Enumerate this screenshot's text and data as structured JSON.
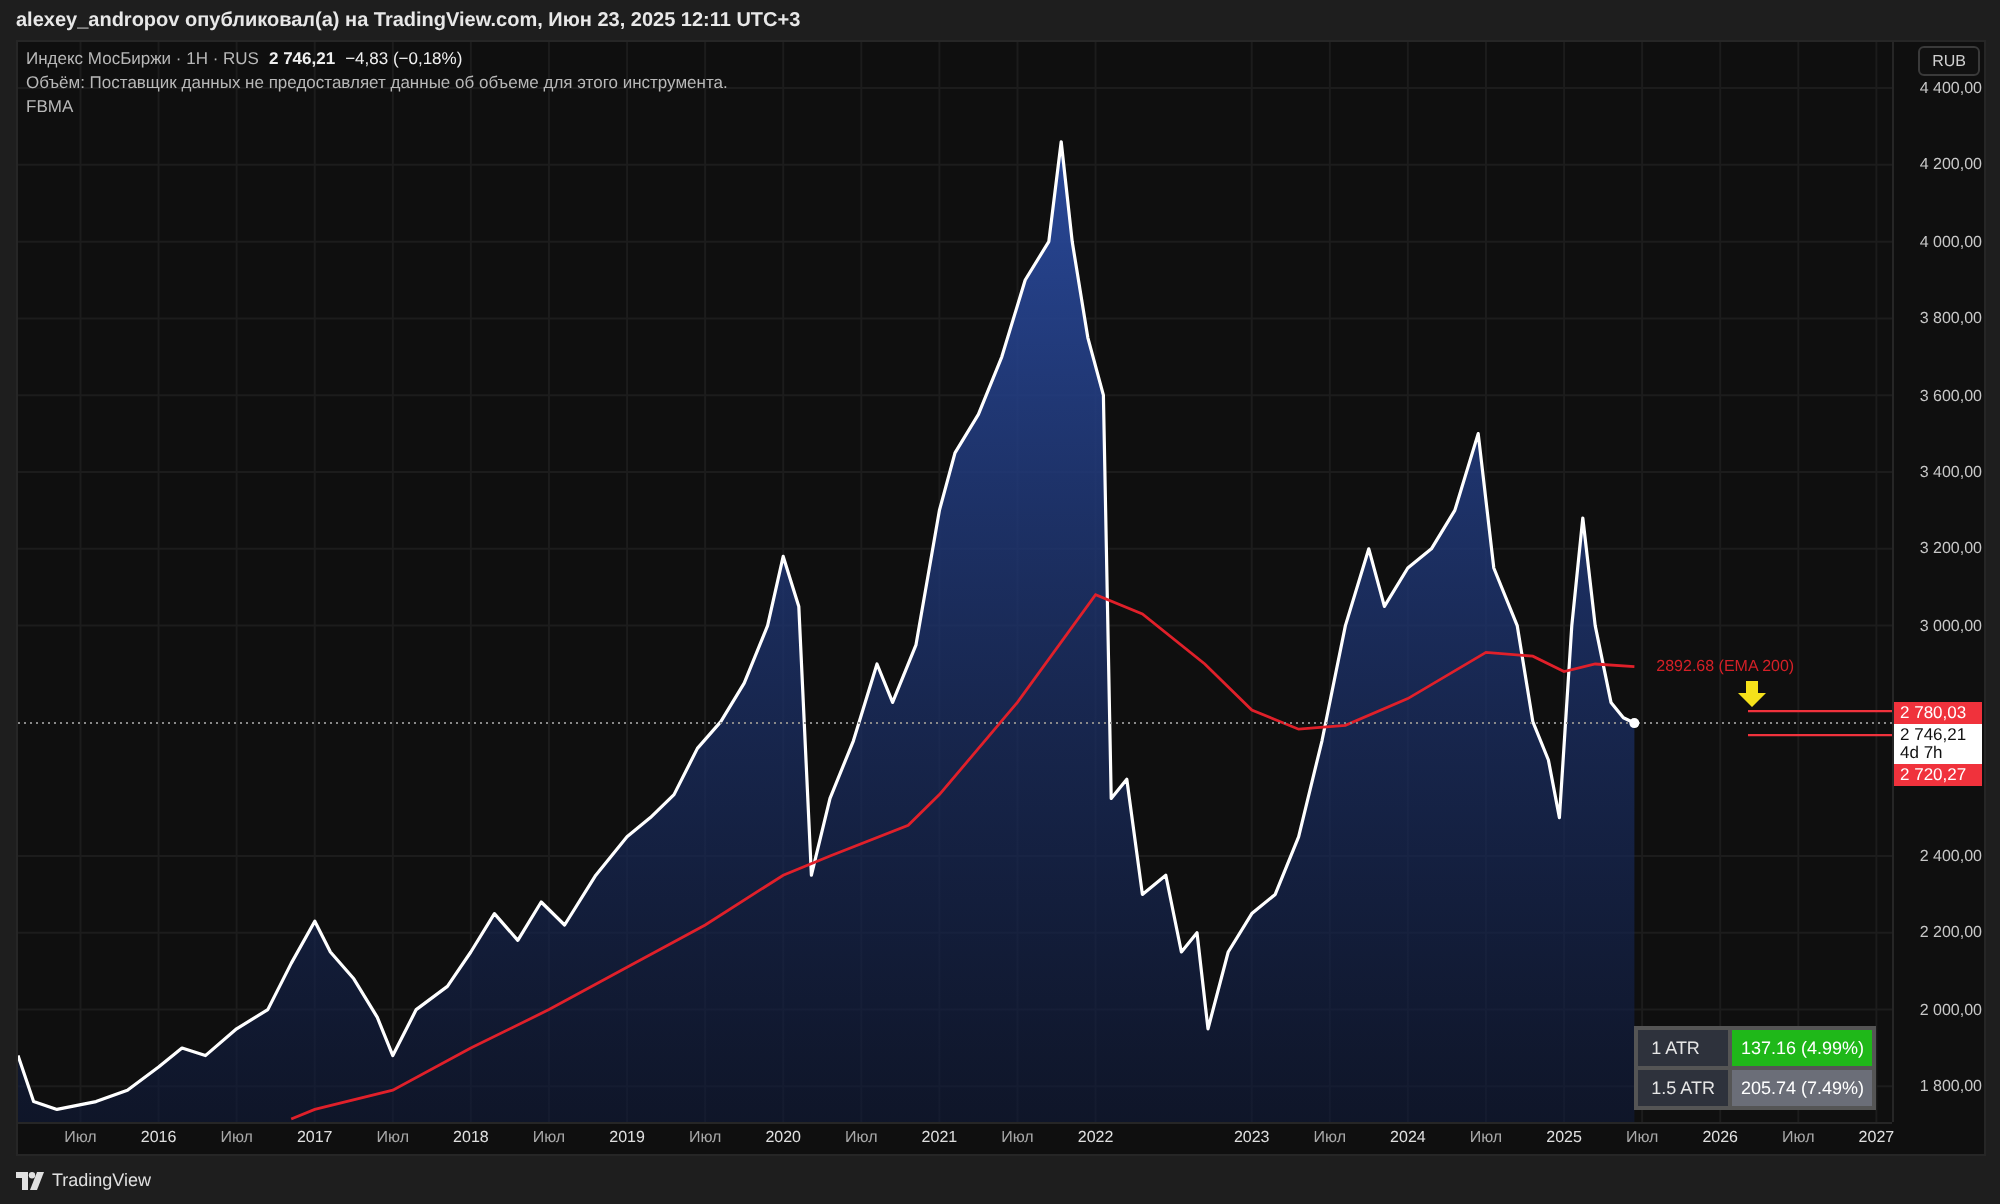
{
  "header": {
    "caption": "alexey_andropov опубликовал(а) на TradingView.com, Июн 23, 2025 12:11 UTC+3"
  },
  "legend": {
    "symbol": "Индекс МосБиржи · 1H · RUS",
    "price": "2 746,21",
    "change": "−4,83 (−0,18%)",
    "volume_note": "Объём: Поставщик данных не предоставляет данные об объеме для этого инструмента.",
    "indicator": "FBMA"
  },
  "currency_button": "RUB",
  "chart": {
    "chart_data": {
      "type": "area",
      "xlim": [
        2015.1,
        2027.1
      ],
      "ylim": [
        1707,
        4520
      ],
      "series": [
        {
          "color": "#ffffff",
          "x": [
            2015.1,
            2015.2,
            2015.35,
            2015.6,
            2015.8,
            2016.0,
            2016.15,
            2016.3,
            2016.5,
            2016.7,
            2016.85,
            2017.0,
            2017.1,
            2017.25,
            2017.4,
            2017.5,
            2017.65,
            2017.85,
            2018.0,
            2018.15,
            2018.3,
            2018.45,
            2018.6,
            2018.8,
            2019.0,
            2019.15,
            2019.3,
            2019.45,
            2019.6,
            2019.75,
            2019.9,
            2020.0,
            2020.1,
            2020.18,
            2020.3,
            2020.45,
            2020.6,
            2020.7,
            2020.85,
            2021.0,
            2021.1,
            2021.25,
            2021.4,
            2021.55,
            2021.7,
            2021.78,
            2021.85,
            2021.95,
            2022.05,
            2022.1,
            2022.2,
            2022.3,
            2022.45,
            2022.55,
            2022.65,
            2022.72,
            2022.85,
            2023.0,
            2023.15,
            2023.3,
            2023.45,
            2023.6,
            2023.75,
            2023.85,
            2024.0,
            2024.15,
            2024.3,
            2024.45,
            2024.55,
            2024.7,
            2024.8,
            2024.9,
            2024.97,
            2025.05,
            2025.12,
            2025.2,
            2025.3,
            2025.38,
            2025.45
          ],
          "values": [
            1880,
            1760,
            1740,
            1760,
            1790,
            1850,
            1900,
            1880,
            1950,
            2000,
            2120,
            2230,
            2150,
            2080,
            1980,
            1880,
            2000,
            2060,
            2150,
            2250,
            2180,
            2280,
            2220,
            2350,
            2450,
            2500,
            2560,
            2680,
            2750,
            2850,
            3000,
            3180,
            3050,
            2350,
            2550,
            2700,
            2900,
            2800,
            2950,
            3300,
            3450,
            3550,
            3700,
            3900,
            4000,
            4260,
            4000,
            3750,
            3600,
            2550,
            2600,
            2300,
            2350,
            2150,
            2200,
            1950,
            2150,
            2250,
            2300,
            2450,
            2700,
            3000,
            3200,
            3050,
            3150,
            3200,
            3300,
            3500,
            3150,
            3000,
            2750,
            2650,
            2500,
            3000,
            3280,
            3000,
            2800,
            2760,
            2746
          ]
        },
        {
          "type": "line",
          "color": "#e0202a",
          "x": [
            2016.85,
            2017.0,
            2017.5,
            2018.0,
            2018.5,
            2019.0,
            2019.5,
            2020.0,
            2020.3,
            2020.8,
            2021.0,
            2021.5,
            2022.0,
            2022.3,
            2022.7,
            2023.0,
            2023.3,
            2023.6,
            2024.0,
            2024.5,
            2024.8,
            2025.0,
            2025.2,
            2025.45
          ],
          "values": [
            1715,
            1740,
            1790,
            1900,
            2000,
            2110,
            2220,
            2350,
            2400,
            2480,
            2560,
            2800,
            3080,
            3030,
            2900,
            2780,
            2730,
            2740,
            2810,
            2930,
            2920,
            2880,
            2900,
            2893
          ]
        }
      ],
      "yticks": [
        {
          "value": 1800,
          "label": "1 800,00"
        },
        {
          "value": 2000,
          "label": "2 000,00"
        },
        {
          "value": 2200,
          "label": "2 200,00"
        },
        {
          "value": 2400,
          "label": "2 400,00"
        },
        {
          "value": 3000,
          "label": "3 000,00"
        },
        {
          "value": 3200,
          "label": "3 200,00"
        },
        {
          "value": 3400,
          "label": "3 400,00"
        },
        {
          "value": 3600,
          "label": "3 600,00"
        },
        {
          "value": 3800,
          "label": "3 800,00"
        },
        {
          "value": 4000,
          "label": "4 000,00"
        },
        {
          "value": 4200,
          "label": "4 200,00"
        },
        {
          "value": 4400,
          "label": "4 400,00"
        }
      ],
      "xticks": [
        {
          "value": 2015.5,
          "label": "Июл"
        },
        {
          "value": 2016,
          "label": "2016"
        },
        {
          "value": 2016.5,
          "label": "Июл"
        },
        {
          "value": 2017,
          "label": "2017"
        },
        {
          "value": 2017.5,
          "label": "Июл"
        },
        {
          "value": 2018,
          "label": "2018"
        },
        {
          "value": 2018.5,
          "label": "Июл"
        },
        {
          "value": 2019,
          "label": "2019"
        },
        {
          "value": 2019.5,
          "label": "Июл"
        },
        {
          "value": 2020,
          "label": "2020"
        },
        {
          "value": 2020.5,
          "label": "Июл"
        },
        {
          "value": 2021,
          "label": "2021"
        },
        {
          "value": 2021.5,
          "label": "Июл"
        },
        {
          "value": 2022,
          "label": "2022"
        },
        {
          "value": 2023,
          "label": "2023"
        },
        {
          "value": 2023.5,
          "label": "Июл"
        },
        {
          "value": 2024,
          "label": "2024"
        },
        {
          "value": 2024.5,
          "label": "Июл"
        },
        {
          "value": 2025,
          "label": "2025"
        },
        {
          "value": 2025.5,
          "label": "Июл"
        },
        {
          "value": 2026,
          "label": "2026"
        },
        {
          "value": 2026.5,
          "label": "Июл"
        },
        {
          "value": 2027,
          "label": "2027"
        }
      ],
      "grid": true,
      "ref_lines": [
        {
          "axis": "y",
          "value": 2746,
          "color": "#8a8a8a"
        }
      ],
      "annotations": [
        "2892.68 (EMA 200)"
      ]
    }
  },
  "last_price_tag": {
    "price": "2 746,21",
    "countdown": "4d 7h"
  },
  "levels": [
    {
      "kind": "upper",
      "label": "2 780,03"
    },
    {
      "kind": "lower",
      "label": "2 720,27"
    }
  ],
  "atr_table": [
    {
      "label": "1 ATR",
      "value": "137.16 (4.99%)",
      "color": "#1fb819"
    },
    {
      "label": "1.5 ATR",
      "value": "205.74 (7.49%)",
      "color": "#6b6e78"
    }
  ],
  "footer": {
    "brand": "TradingView"
  }
}
